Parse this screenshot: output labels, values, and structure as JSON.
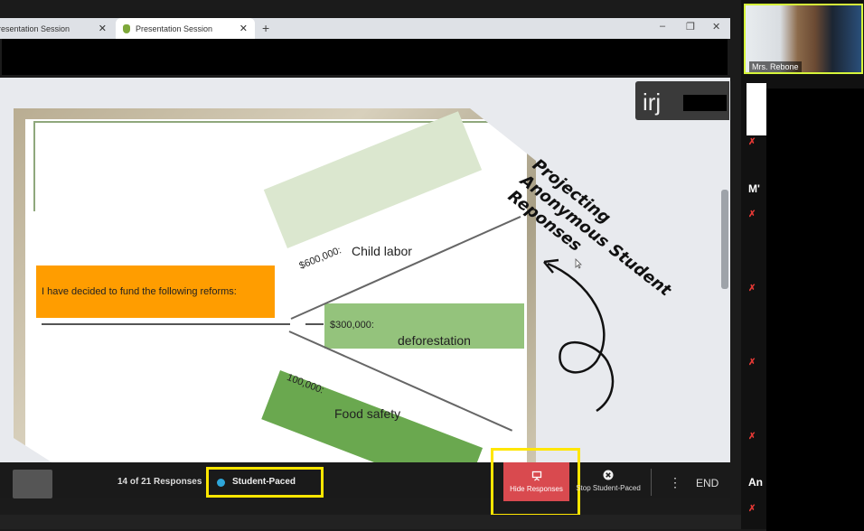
{
  "browser": {
    "tabs": [
      {
        "label": "Presentation Session",
        "active": false
      },
      {
        "label": "Presentation Session",
        "active": true
      }
    ],
    "new_tab": "+",
    "window_controls": {
      "minimize": "–",
      "restore": "❐",
      "close": "✕"
    }
  },
  "slide": {
    "intro": "I have decided to fund the following reforms:",
    "reforms": [
      {
        "amount": "$600,000:",
        "label": "Child labor",
        "color": "#dbe7cf"
      },
      {
        "amount": "$300,000:",
        "label": "deforestation",
        "color": "#94c37c"
      },
      {
        "amount": "100,000:",
        "label": "Food safety",
        "color": "#6aa84f"
      }
    ],
    "intro_color": "#ff9d00"
  },
  "annotation": {
    "text": "Projecting Anonymous Student Reponses"
  },
  "overlay": {
    "initials": "irj"
  },
  "toolbar": {
    "responses": "14 of 21 Responses",
    "mode": "Student-Paced",
    "hide_responses": "Hide Responses",
    "stop_student_paced": "Stop Student-Paced",
    "more": "⋮",
    "end": "END"
  },
  "zoom": {
    "teacher_name": "Mrs. Rebone",
    "participants": [
      "M'",
      "An"
    ],
    "highlight_color": "#ffe600"
  }
}
